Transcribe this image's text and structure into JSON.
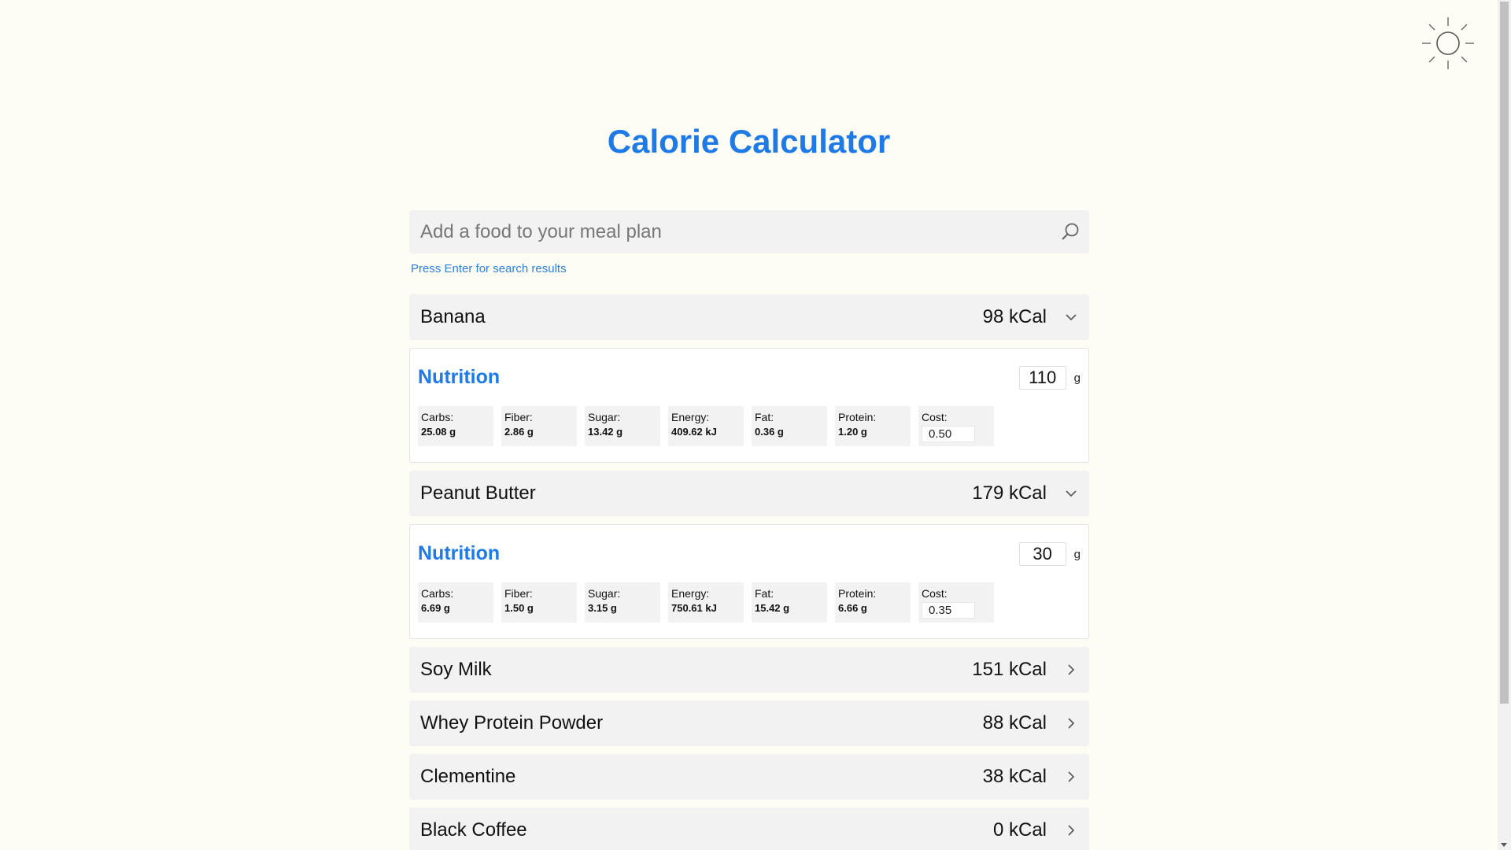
{
  "app": {
    "title": "Calorie Calculator"
  },
  "search": {
    "placeholder": "Add a food to your meal plan",
    "value": "",
    "hint": "Press Enter for search results"
  },
  "labels": {
    "nutrition": "Nutrition",
    "unit": "g",
    "carbs": "Carbs:",
    "fiber": "Fiber:",
    "sugar": "Sugar:",
    "energy": "Energy:",
    "fat": "Fat:",
    "protein": "Protein:",
    "cost": "Cost:"
  },
  "foods": [
    {
      "name": "Banana",
      "kcal": "98 kCal",
      "expanded": true,
      "grams": "110",
      "carbs": "25.08 g",
      "fiber": "2.86 g",
      "sugar": "13.42 g",
      "energy": "409.62 kJ",
      "fat": "0.36 g",
      "protein": "1.20 g",
      "cost": "0.50"
    },
    {
      "name": "Peanut Butter",
      "kcal": "179 kCal",
      "expanded": true,
      "grams": "30",
      "carbs": "6.69 g",
      "fiber": "1.50 g",
      "sugar": "3.15 g",
      "energy": "750.61 kJ",
      "fat": "15.42 g",
      "protein": "6.66 g",
      "cost": "0.35"
    },
    {
      "name": "Soy Milk",
      "kcal": "151 kCal",
      "expanded": false
    },
    {
      "name": "Whey Protein Powder",
      "kcal": "88 kCal",
      "expanded": false
    },
    {
      "name": "Clementine",
      "kcal": "38 kCal",
      "expanded": false
    },
    {
      "name": "Black Coffee",
      "kcal": "0 kCal",
      "expanded": false
    }
  ],
  "icons": {
    "theme": "sun-icon",
    "search": "search-icon",
    "expanded": "chevron-down-icon",
    "collapsed": "chevron-right-icon"
  },
  "colors": {
    "accent": "#1e7ae6",
    "background": "#fdfdf5",
    "row": "#f2f2f2"
  }
}
